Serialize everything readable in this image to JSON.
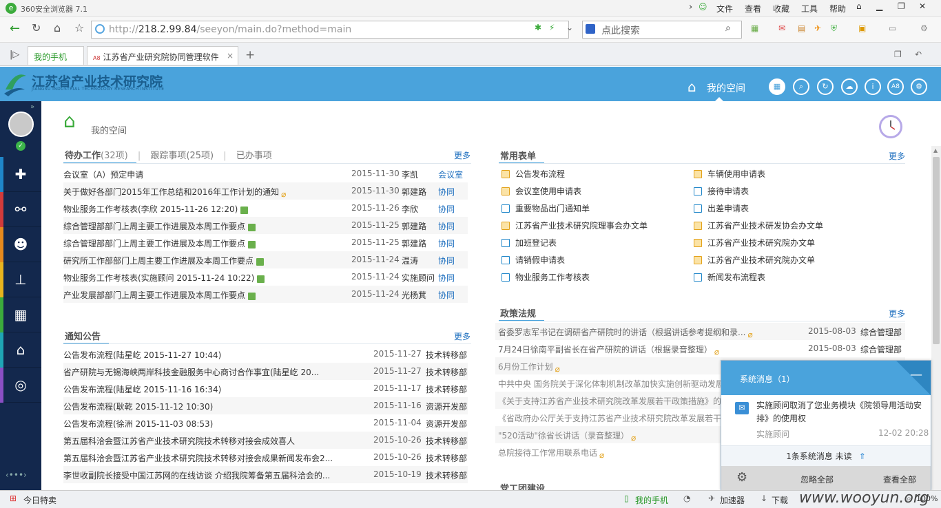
{
  "browser": {
    "title": "360安全浏览器 7.1",
    "menu": [
      "文件",
      "查看",
      "收藏",
      "工具",
      "帮助"
    ],
    "url_prefix": "http://",
    "url_host": "218.2.99.84",
    "url_path": "/seeyon/main.do?method=main",
    "search_placeholder": "点此搜索",
    "tabs": [
      "我的手机",
      "江苏省产业研究院协同管理软件"
    ]
  },
  "app": {
    "logo_cn": "江苏省产业技术研究院",
    "logo_en": "JIANGSU INDUSTRIAL TECHNOLOGY RESEARCH INSTITUTE",
    "nav_myspace": "我的空间",
    "header_icons": [
      "grid-icon",
      "search-icon",
      "refresh-icon",
      "cloud-icon",
      "info-icon",
      "A8",
      "gear-icon"
    ],
    "breadcrumb": "我的空间",
    "accent": "#4aa3dc",
    "sidebar_bg": "#13284d"
  },
  "pending": {
    "tab_active": "待办工作",
    "tab_active_count": "(32项)",
    "tab2": "跟踪事项(25项)",
    "tab3": "已办事项",
    "more": "更多",
    "rows": [
      {
        "title": "会议室（A）预定申请",
        "date": "2015-11-30",
        "person": "李凯",
        "type": "会议室",
        "icon": ""
      },
      {
        "title": "关于做好各部门2015年工作总结和2016年工作计划的通知",
        "date": "2015-11-30",
        "person": "郭建路",
        "type": "协同",
        "icon": "clip"
      },
      {
        "title": "物业服务工作考核表(李欣 2015-11-26 12:20)",
        "date": "2015-11-26",
        "person": "李欣",
        "type": "协同",
        "icon": "form"
      },
      {
        "title": "综合管理部部门上周主要工作进展及本周工作要点",
        "date": "2015-11-25",
        "person": "郭建路",
        "type": "协同",
        "icon": "form"
      },
      {
        "title": "综合管理部部门上周主要工作进展及本周工作要点",
        "date": "2015-11-25",
        "person": "郭建路",
        "type": "协同",
        "icon": "form"
      },
      {
        "title": "研究所工作部部门上周主要工作进展及本周工作要点",
        "date": "2015-11-24",
        "person": "温涛",
        "type": "协同",
        "icon": "form"
      },
      {
        "title": "物业服务工作考核表(实施顾问 2015-11-24 10:22)",
        "date": "2015-11-24",
        "person": "实施顾问",
        "type": "协同",
        "icon": "form"
      },
      {
        "title": "产业发展部部门上周主要工作进展及本周工作要点",
        "date": "2015-11-24",
        "person": "光杨萁",
        "type": "协同",
        "icon": "form"
      }
    ]
  },
  "notice": {
    "title": "通知公告",
    "more": "更多",
    "rows": [
      {
        "title": "公告发布流程(陆星屹 2015-11-27 10:44)",
        "date": "2015-11-27",
        "dept": "技术转移部"
      },
      {
        "title": "省产研院与无锡海峡两岸科技金融服务中心商讨合作事宜(陆星屹 20...",
        "date": "2015-11-27",
        "dept": "技术转移部"
      },
      {
        "title": "公告发布流程(陆星屹 2015-11-16 16:34)",
        "date": "2015-11-17",
        "dept": "技术转移部"
      },
      {
        "title": "公告发布流程(耿乾 2015-11-12 10:30)",
        "date": "2015-11-16",
        "dept": "资源开发部"
      },
      {
        "title": "公告发布流程(徐洲 2015-11-03 08:53)",
        "date": "2015-11-04",
        "dept": "资源开发部"
      },
      {
        "title": "第五届科洽会暨江苏省产业技术研究院技术转移对接会成效喜人",
        "date": "2015-10-26",
        "dept": "技术转移部"
      },
      {
        "title": "第五届科洽会暨江苏省产业技术研究院技术转移对接会成果新闻发布会2...",
        "date": "2015-10-26",
        "dept": "技术转移部"
      },
      {
        "title": "李世收副院长接受中国江苏网的在线访谈 介绍我院筹备第五届科洽会的...",
        "date": "2015-10-19",
        "dept": "技术转移部"
      }
    ]
  },
  "forms": {
    "title": "常用表单",
    "more": "更多",
    "left": [
      "公告发布流程",
      "会议室使用申请表",
      "重要物品出门通知单",
      "江苏省产业技术研究院理事会办文单",
      "加班登记表",
      "请销假申请表",
      "物业服务工作考核表"
    ],
    "right": [
      "车辆使用申请表",
      "接待申请表",
      "出差申请表",
      "江苏省产业技术研发协会办文单",
      "江苏省产业技术研究院办文单",
      "江苏省产业技术研究院办文单",
      "新闻发布流程表"
    ]
  },
  "policy": {
    "title": "政策法规",
    "more": "更多",
    "rows": [
      {
        "title": "省委罗志军书记在调研省产研院时的讲话（根据讲话参考提纲和录...",
        "date": "2015-08-03",
        "dept": "综合管理部"
      },
      {
        "title": "7月24日徐南平副省长在省产研院的讲话（根据录音整理）",
        "date": "2015-08-03",
        "dept": "综合管理部"
      },
      {
        "title": "6月份工作计划",
        "date": "",
        "dept": ""
      },
      {
        "title": "中共中央 国务院关于深化体制机制改革加快实施创新驱动发展",
        "date": "",
        "dept": ""
      },
      {
        "title": "《关于支持江苏省产业技术研究院改革发展若干政策措施》的",
        "date": "",
        "dept": ""
      },
      {
        "title": "《省政府办公厅关于支持江苏省产业技术研究院改革发展若干",
        "date": "",
        "dept": ""
      },
      {
        "title": "\"520活动\"徐省长讲话（录音整理）",
        "date": "",
        "dept": ""
      },
      {
        "title": "总院接待工作常用联系电话",
        "date": "",
        "dept": ""
      }
    ]
  },
  "party": {
    "title": "党工团建设"
  },
  "popup": {
    "title": "系统消息（1）",
    "msg": "实施顾问取消了您业务模块《院领导用活动安排》的使用权",
    "from": "实施顾问",
    "time": "12-02 20:28",
    "count": "1条系统消息 未读",
    "ignore": "忽略全部",
    "view": "查看全部"
  },
  "status": {
    "left": "今日特卖",
    "mobile": "我的手机",
    "accel": "加速器",
    "download": "下载",
    "zoom": "100%",
    "watermark": "www.wooyun.org"
  }
}
